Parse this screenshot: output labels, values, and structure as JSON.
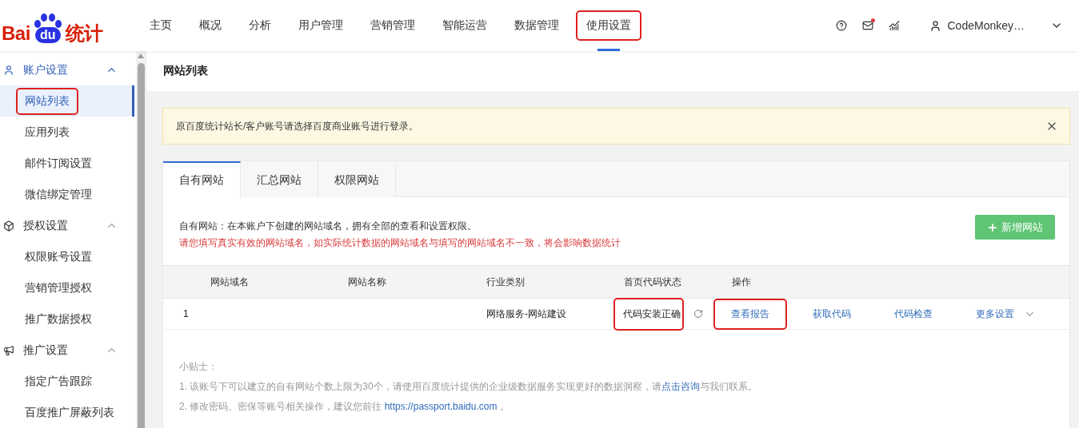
{
  "logo": {
    "text_left": "Bai",
    "text_paw": "du",
    "text_right": "统计"
  },
  "nav": [
    {
      "label": "主页",
      "selected": false,
      "highlighted": false
    },
    {
      "label": "概况",
      "selected": false,
      "highlighted": false
    },
    {
      "label": "分析",
      "selected": false,
      "highlighted": false
    },
    {
      "label": "用户管理",
      "selected": false,
      "highlighted": false
    },
    {
      "label": "营销管理",
      "selected": false,
      "highlighted": false
    },
    {
      "label": "智能运营",
      "selected": false,
      "highlighted": false
    },
    {
      "label": "数据管理",
      "selected": false,
      "highlighted": false
    },
    {
      "label": "使用设置",
      "selected": true,
      "highlighted": true
    }
  ],
  "header_tools": {
    "mail_unread": true
  },
  "user": {
    "name": "CodeMonkey…"
  },
  "sidebar": {
    "groups": [
      {
        "label": "账户设置",
        "kind": "user",
        "expanded": true,
        "active": true,
        "children": [
          {
            "label": "网站列表",
            "selected": true,
            "highlighted": true
          },
          {
            "label": "应用列表",
            "selected": false,
            "highlighted": false
          },
          {
            "label": "邮件订阅设置",
            "selected": false,
            "highlighted": false
          },
          {
            "label": "微信绑定管理",
            "selected": false,
            "highlighted": false
          }
        ]
      },
      {
        "label": "授权设置",
        "kind": "cube",
        "expanded": true,
        "active": false,
        "children": [
          {
            "label": "权限账号设置",
            "selected": false,
            "highlighted": false
          },
          {
            "label": "营销管理授权",
            "selected": false,
            "highlighted": false
          },
          {
            "label": "推广数据授权",
            "selected": false,
            "highlighted": false
          }
        ]
      },
      {
        "label": "推广设置",
        "kind": "megaphone",
        "expanded": true,
        "active": false,
        "children": [
          {
            "label": "指定广告跟踪",
            "selected": false,
            "highlighted": false
          },
          {
            "label": "百度推广屏蔽列表",
            "selected": false,
            "highlighted": false
          }
        ]
      }
    ]
  },
  "page_title": "网站列表",
  "notice": {
    "text": "原百度统计站长/客户账号请选择百度商业账号进行登录。",
    "closable": true
  },
  "tabs": [
    {
      "label": "自有网站",
      "selected": true
    },
    {
      "label": "汇总网站",
      "selected": false
    },
    {
      "label": "权限网站",
      "selected": false
    }
  ],
  "intro": "自有网站：在本账户下创建的网站域名，拥有全部的查看和设置权限。",
  "warning": "请您填写真实有效的网站域名，如实际统计数据的网站域名与填写的网站域名不一致，将会影响数据统计",
  "add_button": {
    "label": "新增网站"
  },
  "table": {
    "columns": [
      "网站域名",
      "网站名称",
      "行业类别",
      "首页代码状态",
      "操作"
    ],
    "rows": [
      {
        "index": "1",
        "industry": "网络服务-网站建设",
        "status": {
          "text": "代码安装正确",
          "highlighted": true
        },
        "actions": [
          {
            "label": "查看报告",
            "highlighted": true
          },
          {
            "label": "获取代码",
            "highlighted": false
          },
          {
            "label": "代码检查",
            "highlighted": false
          },
          {
            "label": "更多设置",
            "highlighted": false
          }
        ]
      }
    ]
  },
  "tips": {
    "title": "小贴士：",
    "lines": [
      {
        "before": "1. 该账号下可以建立的自有网站个数上限为30个，请使用百度统计提供的企业级数据服务实现更好的数据洞察，请",
        "link": "点击咨询",
        "after": "与我们联系。"
      },
      {
        "before": "2. 修改密码、密保等账号相关操作，建议您前往 ",
        "link": "https://passport.baidu.com",
        "after": " 。"
      }
    ]
  }
}
